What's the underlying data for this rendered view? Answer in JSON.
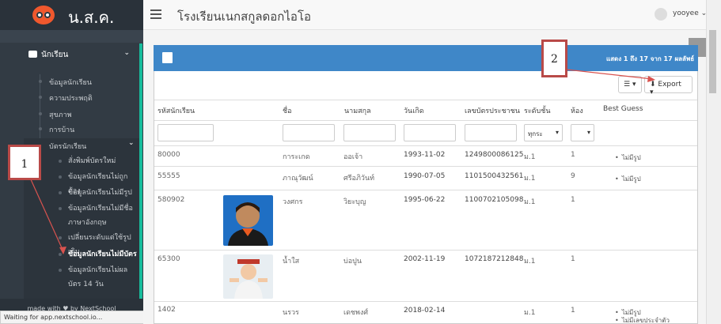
{
  "brand": "น.ส.ค.",
  "header": {
    "title": "โรงเรียนเนกสกูลดอกไอโอ",
    "user": "yooyee"
  },
  "sidebar": {
    "section": "นักเรียน",
    "items": [
      "ข้อมูลนักเรียน",
      "ความประพฤติ",
      "สุขภาพ",
      "การบ้าน"
    ],
    "submenu_title": "บัตรนักเรียน",
    "subitems": [
      "สั่งพิมพ์บัตรใหม่",
      "ข้อมูลนักเรียนไม่ถูกต้อง",
      "ข้อมูลนักเรียนไม่มีรูป",
      "ข้อมูลนักเรียนไม่มีชื่อภาษาอังกฤษ",
      "เปลี่ยนระดับแต่ใช้รูปเดิม",
      "ข้อมูลนักเรียนไม่มีบัตร",
      "ข้อมูลนักเรียนไม่ผลบัตร 14 วัน"
    ],
    "footer": "made with ♥ by NextSchool"
  },
  "status_bar": "Waiting for app.nextschool.io...",
  "panel": {
    "record_info": "แสดง 1 ถึง 17 จาก 17 ผลลัพธ์",
    "export_label": "Export",
    "columns_btn": "☰"
  },
  "table": {
    "headers": [
      "รหัสนักเรียน",
      "",
      "ชื่อ",
      "นามสกุล",
      "วันเกิด",
      "เลขบัตรประชาชน",
      "ระดับชั้น",
      "ห้อง",
      "Best Guess"
    ],
    "level_filter": "ทุกระ",
    "rows": [
      {
        "id": "80000",
        "first": "การะเกด",
        "last": "ออเจ้า",
        "dob": "1993-11-02",
        "nid": "1249800086125",
        "level": "ม.1",
        "room": "1",
        "guess": [
          "ไม่มีรูป"
        ]
      },
      {
        "id": "55555",
        "first": "ภาณุวัฒน์",
        "last": "ศรีอภิวันท์",
        "dob": "1990-07-05",
        "nid": "1101500432561",
        "level": "ม.1",
        "room": "9",
        "guess": [
          "ไม่มีรูป"
        ]
      },
      {
        "id": "580902",
        "first": "วงศกร",
        "last": "วิยะบุญ",
        "dob": "1995-06-22",
        "nid": "1100702105098",
        "level": "ม.1",
        "room": "1",
        "guess": []
      },
      {
        "id": "65300",
        "first": "น้ำใส",
        "last": "บ่อปูน",
        "dob": "2002-11-19",
        "nid": "1072187212848",
        "level": "ม.1",
        "room": "1",
        "guess": []
      },
      {
        "id": "1402",
        "first": "นรวร",
        "last": "เดชพงศ์",
        "dob": "2018-02-14",
        "nid": "",
        "level": "ม.1",
        "room": "1",
        "guess": [
          "ไม่มีรูป",
          "ไม่มีเลขประจำตัว"
        ]
      }
    ]
  },
  "annotations": [
    "1",
    "2"
  ],
  "colors": {
    "sidebar": "#323b44",
    "accent": "#18bc9c",
    "panel_header": "#3f87c8",
    "annotation": "#b94a48"
  }
}
